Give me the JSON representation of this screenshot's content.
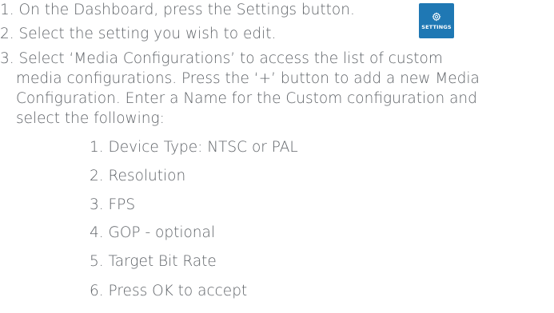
{
  "steps": [
    {
      "number": "1.",
      "text": "On the Dashboard, press the Settings button."
    },
    {
      "number": "2.",
      "text": "Select the setting you wish to edit."
    },
    {
      "number": "3.",
      "lines": [
        "Select ‘Media Configurations’ to access the list of custom",
        "media configurations. Press the ‘+’ button to add a new Media",
        "Configuration. Enter a Name for the Custom configuration and",
        "select the following:"
      ]
    }
  ],
  "substeps": [
    "1. Device Type: NTSC or PAL",
    "2. Resolution",
    "3. FPS",
    "4. GOP - optional",
    "5. Target Bit Rate",
    "6. Press OK to accept"
  ],
  "settings_button": {
    "label": "SETTINGS",
    "icon": "gear-icon",
    "color": "#1f78b4"
  }
}
